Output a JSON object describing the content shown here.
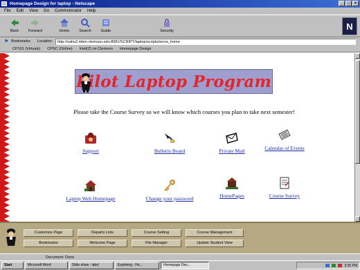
{
  "window": {
    "title": "Homepage Design for laptop - Netscape",
    "buttons": [
      "_",
      "□",
      "×"
    ]
  },
  "menu": [
    "File",
    "Edit",
    "View",
    "Go",
    "Communicator",
    "Help"
  ],
  "toolbar": [
    {
      "label": "Back",
      "icon": "back-arrow-icon"
    },
    {
      "label": "Forward",
      "icon": "forward-arrow-icon"
    },
    {
      "label": "Home",
      "icon": "home-icon"
    },
    {
      "label": "Search",
      "icon": "search-icon"
    },
    {
      "label": "Guide",
      "icon": "guide-icon"
    },
    {
      "label": "Security",
      "icon": "security-lock-icon"
    }
  ],
  "throbber_letter": "N",
  "location": {
    "bookmarks_label": "Bookmarks",
    "location_label": "Location:",
    "url": "http://oahu2.mbm.clemson.edu:8081/SCRIPT/laptop/scripts/serve_home"
  },
  "bookmarks_bar": [
    "CP101 (Virtuals)",
    "CPSC (Online)",
    "Intel(Z) on Clemson",
    "Homepage Design"
  ],
  "page": {
    "banner_title": "Pilot Laptop Program",
    "survey_text": "Please take the Course Survey so we will know which courses you plan to take next semester!",
    "links": [
      {
        "label": "Support",
        "icon": "support-icon"
      },
      {
        "label": "Bulletin Board",
        "icon": "bulletin-board-icon"
      },
      {
        "label": "Private Mail",
        "icon": "mail-icon"
      },
      {
        "label": "Calendar of Events",
        "icon": "calendar-icon"
      },
      {
        "label": "Laptop Web Homepage",
        "icon": "house-icon"
      },
      {
        "label": "Change your password",
        "icon": "key-icon"
      },
      {
        "label": "HomePages",
        "icon": "homepages-icon"
      },
      {
        "label": "Course Survey",
        "icon": "survey-icon"
      }
    ]
  },
  "bottom_nav": [
    [
      "Customize Page",
      "Departs Lists",
      "Course Setting",
      "Course Management"
    ],
    [
      "Bookmarks",
      "Welcome Page",
      "File Manager",
      "Update Student View"
    ]
  ],
  "status_text": "Document: Done",
  "taskbar": {
    "start": "Start",
    "items": [
      "Microsoft Word",
      "Slide show - labs!",
      "Exploring - Ho...",
      "Homepage Des..."
    ],
    "active_index": 3,
    "clock": "3:35 PM"
  }
}
